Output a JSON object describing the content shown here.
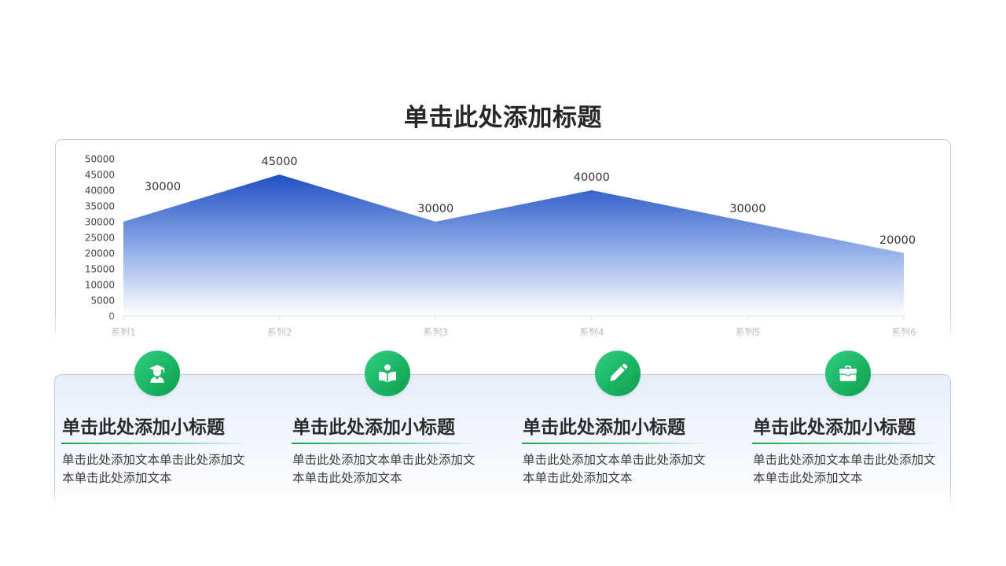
{
  "title": "单击此处添加标题",
  "colors": {
    "area_top": "#1e4fc3",
    "area_bottom": "#ffffff",
    "accent_green": "#13a457"
  },
  "chart_data": {
    "type": "area",
    "categories": [
      "系列1",
      "系列2",
      "系列3",
      "系列4",
      "系列5",
      "系列6"
    ],
    "values": [
      30000,
      45000,
      30000,
      40000,
      30000,
      20000
    ],
    "data_labels": [
      "30000",
      "45000",
      "30000",
      "40000",
      "30000",
      "20000"
    ],
    "ylim": [
      0,
      50000
    ],
    "yticks": [
      "0",
      "5000",
      "10000",
      "15000",
      "20000",
      "25000",
      "30000",
      "35000",
      "40000",
      "45000",
      "50000"
    ],
    "grid": false,
    "legend": "none"
  },
  "items": [
    {
      "icon": "graduate-icon",
      "title": "单击此处添加小标题",
      "text": "单击此处添加文本单击此处添加文本单击此处添加文本"
    },
    {
      "icon": "book-reader-icon",
      "title": "单击此处添加小标题",
      "text": "单击此处添加文本单击此处添加文本单击此处添加文本"
    },
    {
      "icon": "pencil-icon",
      "title": "单击此处添加小标题",
      "text": "单击此处添加文本单击此处添加文本单击此处添加文本"
    },
    {
      "icon": "briefcase-icon",
      "title": "单击此处添加小标题",
      "text": "单击此处添加文本单击此处添加文本单击此处添加文本"
    }
  ]
}
